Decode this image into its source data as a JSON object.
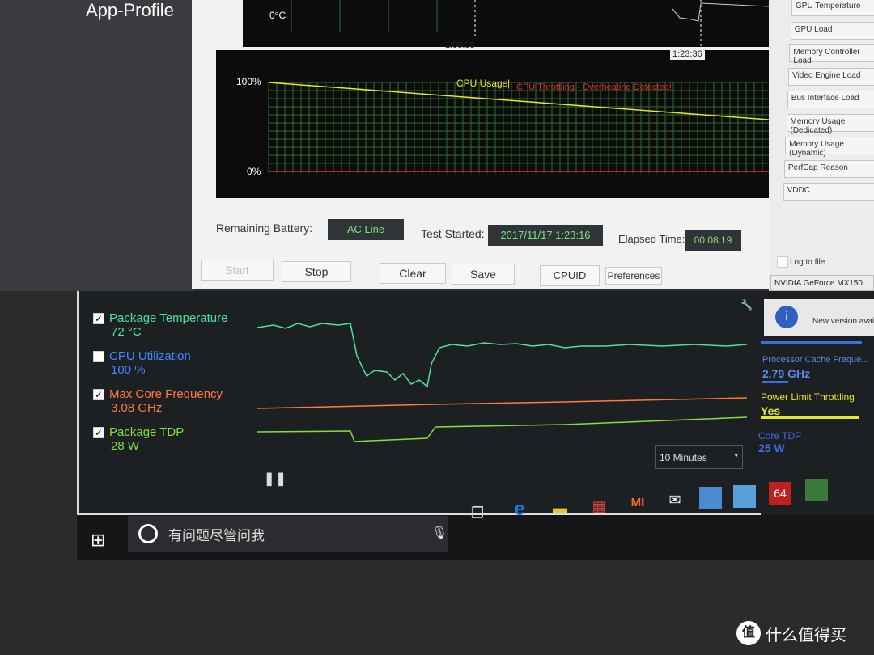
{
  "app": {
    "title": "App-Profile"
  },
  "temp_chart": {
    "axis_label": "0°C",
    "times": [
      "1:08:58",
      "1:23:36"
    ]
  },
  "cpu_chart": {
    "y_max": "100%",
    "y_min": "0%",
    "legend_usage": "CPU Usage",
    "legend_sep": "|",
    "legend_throttle": "CPU Throttling - Overheating Detected!",
    "colors": {
      "usage": "#e6e62a",
      "throttle": "#e03030",
      "grid": "#2f6b2f"
    }
  },
  "status": {
    "battery_label": "Remaining Battery:",
    "battery_value": "AC Line",
    "started_label": "Test Started:",
    "started_value": "2017/11/17 1:23:16",
    "elapsed_label": "Elapsed Time:",
    "elapsed_value": "00:08:19"
  },
  "buttons": {
    "start": "Start",
    "stop": "Stop",
    "clear": "Clear",
    "save": "Save",
    "cpuid": "CPUID",
    "preferences": "Preferences"
  },
  "gpu": {
    "items": [
      "GPU Temperature",
      "GPU Load",
      "Memory Controller Load",
      "Video Engine Load",
      "Bus Interface Load",
      "Memory Usage (Dedicated)",
      "Memory Usage (Dynamic)",
      "PerfCap Reason",
      "VDDC"
    ],
    "log_to_file": "Log to file",
    "device": "NVIDIA GeForce MX150"
  },
  "xtu": {
    "metrics": [
      {
        "name": "Package Temperature",
        "value": "72 °C",
        "checked": true,
        "color": "#4fe0a0"
      },
      {
        "name": "CPU Utilization",
        "value": "100 %",
        "checked": false,
        "color": "#3a8cff"
      },
      {
        "name": "Max Core Frequency",
        "value": "3.08 GHz",
        "checked": true,
        "color": "#ff7a3a"
      },
      {
        "name": "Package TDP",
        "value": "28 W",
        "checked": true,
        "color": "#7fe040"
      }
    ],
    "range": "10 Minutes"
  },
  "side": {
    "notice": "New version availab",
    "cache_label": "Processor Cache Freque...",
    "cache_value": "2.79 GHz",
    "plt_label": "Power Limit Throttling",
    "plt_value": "Yes",
    "tdp_label": "Core TDP",
    "tdp_value": "25 W"
  },
  "taskbar": {
    "search_placeholder": "有问题尽管问我",
    "icons": [
      "windows-icon",
      "cortana-icon",
      "microphone-icon",
      "task-view-icon",
      "edge-icon",
      "file-explorer-icon",
      "store-icon",
      "mi-icon",
      "mail-icon",
      "app-icon-1",
      "app-icon-2",
      "aida64-icon",
      "gpuz-icon"
    ],
    "aida_label": "64",
    "mi_label": "MI"
  },
  "watermark": "什么值得买"
}
